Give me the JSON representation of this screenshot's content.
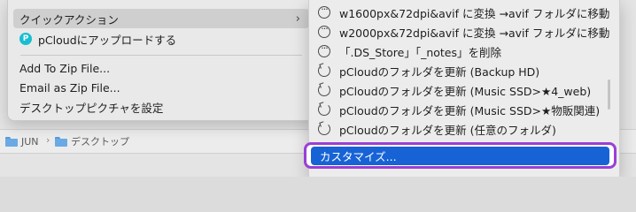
{
  "finder": {
    "path": [
      {
        "label": "JUN"
      },
      {
        "label": "デスクトップ"
      }
    ],
    "path_separator": "›"
  },
  "context_menu": {
    "quick_actions_label": "クイックアクション",
    "submenu_arrow": "›",
    "pcloud_upload_label": "pCloudにアップロードする",
    "add_to_zip_label": "Add To Zip File...",
    "email_as_zip_label": "Email as Zip File...",
    "desktop_picture_label": "デスクトップピクチャを設定"
  },
  "quick_actions_submenu": {
    "items": [
      {
        "label": "w1600px&72dpi&avif に変換 →avif フォルダに移動",
        "icon": "workflow-dots-icon"
      },
      {
        "label": "w2000px&72dpi&avif に変換 →avif フォルダに移動",
        "icon": "workflow-dots-icon"
      },
      {
        "label": "「.DS_Store」「_notes」を削除",
        "icon": "workflow-dots-icon"
      },
      {
        "label": "pCloudのフォルダを更新 (Backup HD)",
        "icon": "refresh-icon"
      },
      {
        "label": "pCloudのフォルダを更新 (Music SSD>★4_web)",
        "icon": "refresh-icon"
      },
      {
        "label": "pCloudのフォルダを更新 (Music SSD>★物販関連)",
        "icon": "refresh-icon"
      },
      {
        "label": "pCloudのフォルダを更新 (任意のフォルダ)",
        "icon": "refresh-icon"
      }
    ],
    "customize_label": "カスタマイズ..."
  },
  "colors": {
    "highlight_blue": "#1763d6",
    "annotation_purple": "#9a3fd6",
    "pcloud_teal": "#17bed0"
  }
}
